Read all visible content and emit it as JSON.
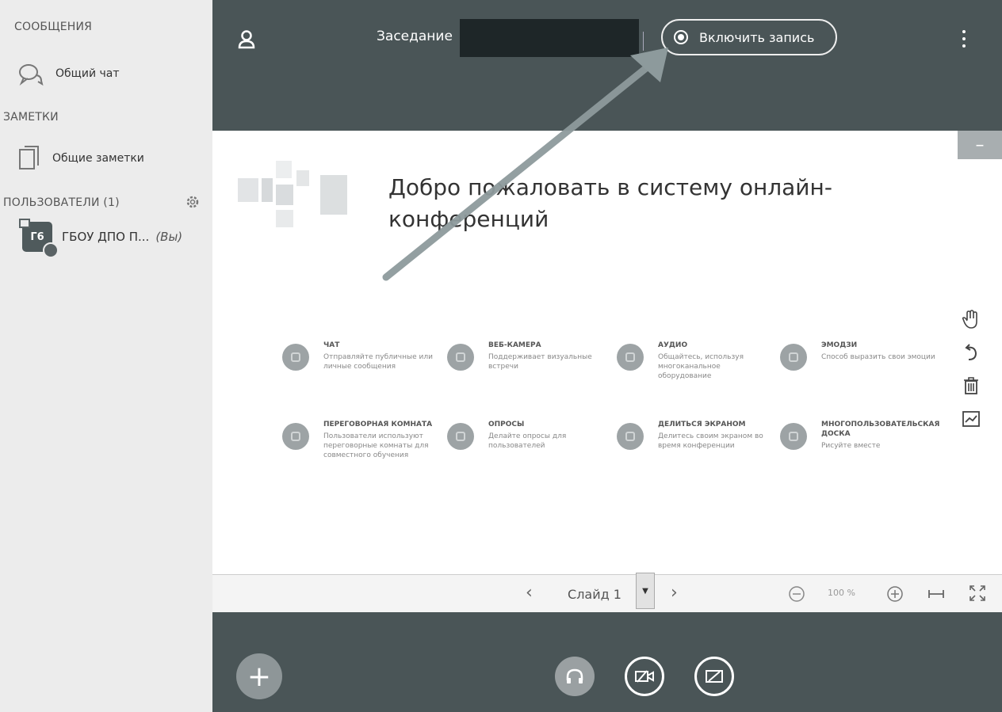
{
  "sidebar": {
    "messages_title": "СООБЩЕНИЯ",
    "public_chat": "Общий чат",
    "notes_title": "ЗАМЕТКИ",
    "shared_notes": "Общие заметки",
    "users_title": "ПОЛЬЗОВАТЕЛИ (1)",
    "user": {
      "initials": "Г6",
      "name": "ГБОУ ДПО П...",
      "you_label": "(Вы)"
    }
  },
  "header": {
    "meeting_title": "Заседание",
    "record_button": "Включить запись"
  },
  "slide": {
    "welcome": "Добро пожаловать в систему онлайн-конференций",
    "features": [
      {
        "title": "ЧАТ",
        "desc": "Отправляйте публичные или личные сообщения"
      },
      {
        "title": "ВЕБ-КАМЕРА",
        "desc": "Поддерживает визуальные встречи"
      },
      {
        "title": "АУДИО",
        "desc": "Общайтесь, используя многоканальное оборудование"
      },
      {
        "title": "ЭМОДЗИ",
        "desc": "Способ выразить свои эмоции"
      },
      {
        "title": "ПЕРЕГОВОРНАЯ КОМНАТА",
        "desc": "Пользователи используют переговорные комнаты для совместного обучения"
      },
      {
        "title": "ОПРОСЫ",
        "desc": "Делайте опросы для пользователей"
      },
      {
        "title": "ДЕЛИТЬСЯ ЭКРАНОМ",
        "desc": "Делитесь своим экраном во время конференции"
      },
      {
        "title": "МНОГОПОЛЬЗОВАТЕЛЬСКАЯ ДОСКА",
        "desc": "Рисуйте вместе"
      }
    ]
  },
  "navbar": {
    "slide_label": "Слайд 1",
    "zoom": "100 %"
  },
  "icons": {
    "minimize": "minus-icon",
    "tools": [
      "hand-icon",
      "undo-icon",
      "trash-icon",
      "chart-icon"
    ]
  },
  "colors": {
    "bar": "#4a5557",
    "sidebar": "#ececec",
    "arrow": "#8d9a9c"
  }
}
